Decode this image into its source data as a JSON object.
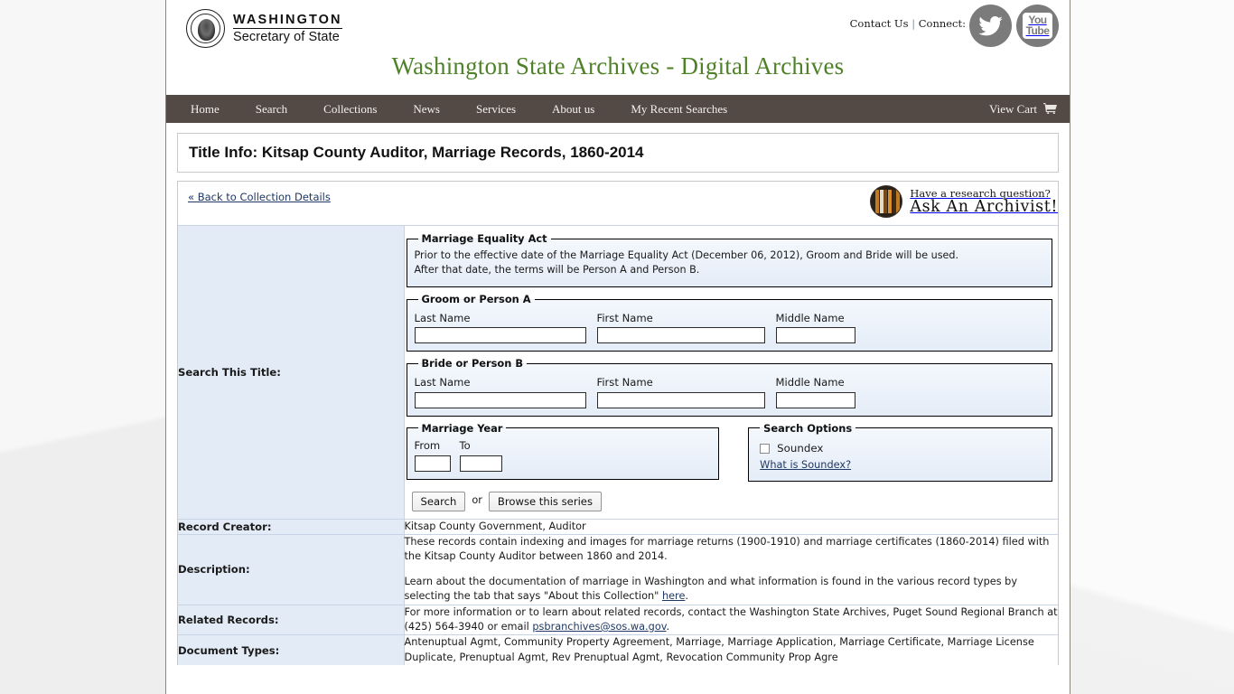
{
  "header": {
    "logo_line1": "WASHINGTON",
    "logo_line2": "Secretary of State",
    "contact_us": "Contact Us",
    "separator": "|",
    "connect": "Connect:",
    "site_title": "Washington State Archives - Digital Archives",
    "social": [
      {
        "name": "twitter-icon",
        "label": "Twitter"
      },
      {
        "name": "youtube-icon",
        "label": "YouTube",
        "line1": "You",
        "line2": "Tube"
      }
    ]
  },
  "nav": {
    "items": [
      {
        "label": "Home"
      },
      {
        "label": "Search"
      },
      {
        "label": "Collections"
      },
      {
        "label": "News"
      },
      {
        "label": "Services"
      },
      {
        "label": "About us"
      },
      {
        "label": "My Recent Searches"
      }
    ],
    "view_cart": "View Cart"
  },
  "page_title": "Title Info: Kitsap County Auditor, Marriage Records, 1860-2014",
  "back_link": "« Back to Collection Details",
  "ask_archivist": {
    "line1": "Have a research question?",
    "line2": "Ask An Archivist!"
  },
  "search_panel": {
    "row_label": "Search This Title:",
    "marriage_equality": {
      "legend": "Marriage Equality Act",
      "line1": "Prior to the effective date of the Marriage Equality Act (December 06, 2012), Groom and Bride will be used.",
      "line2": "After that date, the terms will be Person A and Person B."
    },
    "groom": {
      "legend": "Groom or Person A",
      "last_name_label": "Last Name",
      "first_name_label": "First Name",
      "middle_name_label": "Middle Name",
      "last_name_value": "",
      "first_name_value": "",
      "middle_name_value": ""
    },
    "bride": {
      "legend": "Bride or Person B",
      "last_name_label": "Last Name",
      "first_name_label": "First Name",
      "middle_name_label": "Middle Name",
      "last_name_value": "",
      "first_name_value": "",
      "middle_name_value": ""
    },
    "marriage_year": {
      "legend": "Marriage Year",
      "from_label": "From",
      "to_label": "To",
      "from_value": "",
      "to_value": ""
    },
    "search_options": {
      "legend": "Search Options",
      "soundex_label": "Soundex",
      "soundex_checked": false,
      "what_is_soundex": "What is Soundex?"
    },
    "search_button": "Search",
    "or_word": "or",
    "browse_button": "Browse this series"
  },
  "details": [
    {
      "label": "Record Creator:",
      "paragraphs": [
        "Kitsap County Government, Auditor"
      ]
    },
    {
      "label": "Description:",
      "paragraphs": [
        "These records contain indexing and images for marriage returns (1900-1910) and marriage certificates (1860-2014) filed with the Kitsap County Auditor between 1860 and 2014.",
        "Learn about the documentation of marriage in Washington and what information is found in the various record types by selecting the tab that says \"About this Collection\" here."
      ],
      "link_text": "here"
    },
    {
      "label": "Related Records:",
      "paragraphs": [
        "For more information or to learn about related records, contact the Washington State Archives, Puget Sound Regional Branch at (425) 564-3940 or email psbranchives@sos.wa.gov."
      ],
      "link_text": "psbranchives@sos.wa.gov"
    },
    {
      "label": "Document Types:",
      "paragraphs": [
        "Antenuptual Agmt, Community Property Agreement, Marriage, Marriage Application, Marriage Certificate, Marriage License Duplicate, Prenuptual Agmt, Rev Prenuptual Agmt, Revocation Community Prop Agre"
      ]
    }
  ],
  "colors": {
    "nav_bg": "#534a45",
    "title_green": "#4f8228",
    "label_cell_bg": "#e3ebf6",
    "link_blue": "#1f3864",
    "social_gray": "#7b7b7b"
  }
}
